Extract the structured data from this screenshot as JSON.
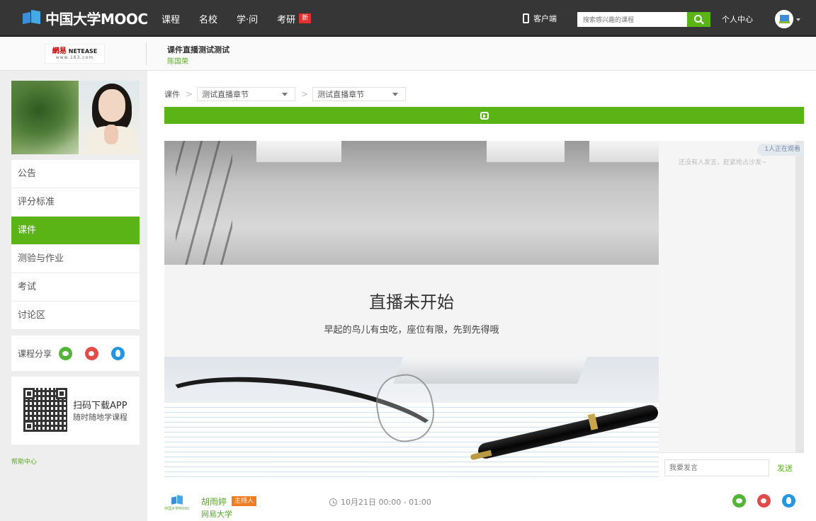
{
  "topnav": {
    "logo_text": "中国大学MOOC",
    "items": [
      {
        "label": "课程"
      },
      {
        "label": "名校"
      },
      {
        "label": "学·问"
      },
      {
        "label": "考研",
        "badge": "新"
      }
    ],
    "client_label": "客户端",
    "search_placeholder": "搜索感兴趣的课程",
    "user_center": "个人中心"
  },
  "course_header": {
    "partner_logo_main": "網易",
    "partner_logo_brand": "NETEASE",
    "partner_logo_url": "www.163.com",
    "title": "课件直播测试测试",
    "teacher": "陈国荣"
  },
  "sidebar": {
    "menu": [
      {
        "label": "公告",
        "active": false
      },
      {
        "label": "评分标准",
        "active": false
      },
      {
        "label": "课件",
        "active": true
      },
      {
        "label": "测验与作业",
        "active": false
      },
      {
        "label": "考试",
        "active": false
      },
      {
        "label": "讨论区",
        "active": false
      }
    ],
    "share_label": "课程分享",
    "app_title": "扫码下载APP",
    "app_subtitle": "随时随地学课程",
    "help": "帮助中心"
  },
  "breadcrumb": {
    "root": "课件",
    "sep": ">",
    "select1": "测试直播章节",
    "select2": "测试直播章节"
  },
  "live": {
    "title": "直播未开始",
    "subtitle": "早起的鸟儿有虫吃，座位有限，先到先得哦"
  },
  "chat": {
    "watching": "1人正在观看",
    "empty_text": "还没有人发言，赶紧抢占沙发~",
    "input_placeholder": "我要发言",
    "send": "发送"
  },
  "host": {
    "logo_text": "中国大学MOOC",
    "name": "胡雨婷",
    "badge": "主持人",
    "school": "网易大学",
    "time": "10月21日 00:00 - 01:00"
  },
  "colors": {
    "accent": "#5ab415",
    "topbar": "#363636",
    "host_badge": "#f07c23",
    "new_badge": "#e52f2f"
  }
}
